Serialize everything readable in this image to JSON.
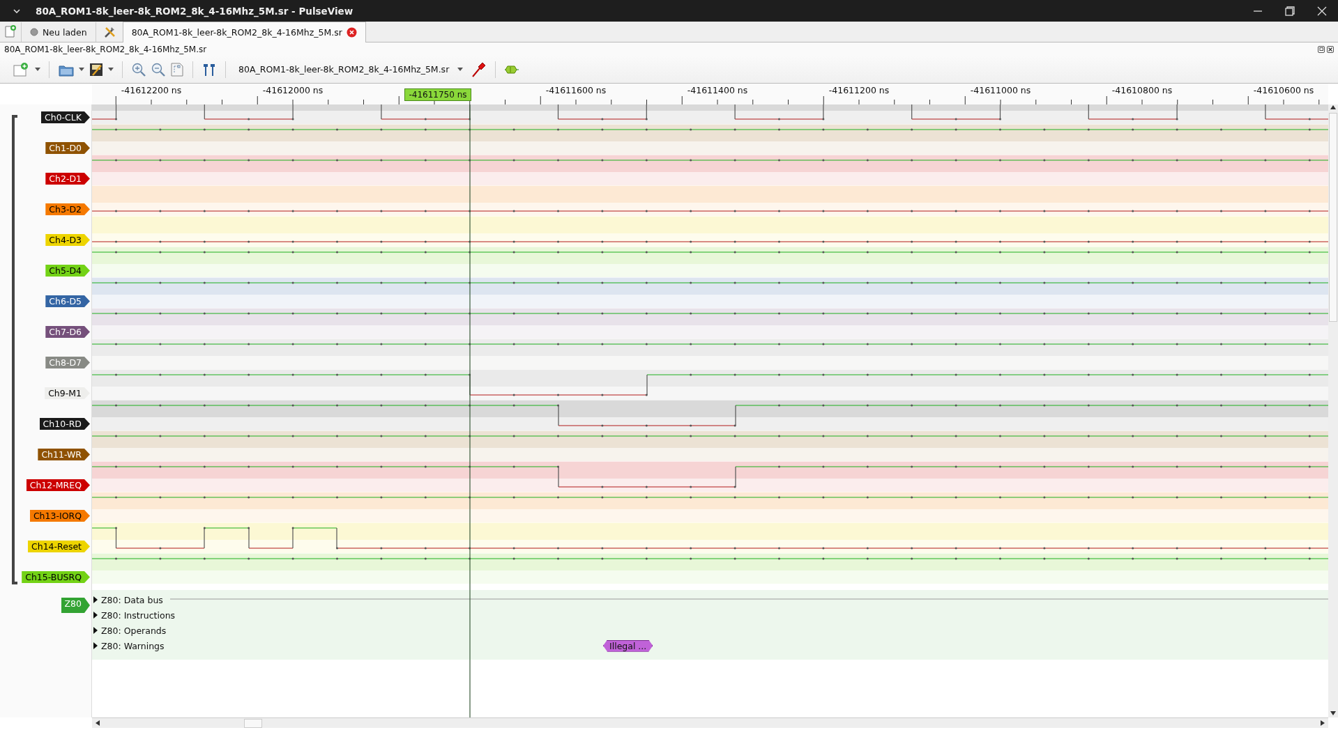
{
  "window": {
    "title": "80A_ROM1-8k_leer-8k_ROM2_8k_4-16Mhz_5M.sr - PulseView"
  },
  "tabs": [
    {
      "kind": "reload",
      "label": "Neu laden",
      "selected": false
    },
    {
      "kind": "session",
      "label": "80A_ROM1-8k_leer-8k_ROM2_8k_4-16Mhz_5M.sr",
      "selected": true
    }
  ],
  "session_label": "80A_ROM1-8k_leer-8k_ROM2_8k_4-16Mhz_5M.sr",
  "toolbar": {
    "device": "80A_ROM1-8k_leer-8k_ROM2_8k_4-16Mhz_5M.sr"
  },
  "ruler": {
    "labels": [
      "-41612200 ns",
      "-41612000 ns",
      "-41611600 ns",
      "-41611400 ns",
      "-41611200 ns",
      "-41611000 ns",
      "-41610800 ns",
      "-41610600 ns"
    ],
    "cursor": "-41611750 ns"
  },
  "channels": [
    {
      "name": "Ch0-CLK",
      "color": "#1b1b1b"
    },
    {
      "name": "Ch1-D0",
      "color": "#8f5202"
    },
    {
      "name": "Ch2-D1",
      "color": "#cc0000"
    },
    {
      "name": "Ch3-D2",
      "color": "#f57900"
    },
    {
      "name": "Ch4-D3",
      "color": "#edd400"
    },
    {
      "name": "Ch5-D4",
      "color": "#73d216"
    },
    {
      "name": "Ch6-D5",
      "color": "#3465a4"
    },
    {
      "name": "Ch7-D6",
      "color": "#75507b"
    },
    {
      "name": "Ch8-D7",
      "color": "#888a85"
    },
    {
      "name": "Ch9-M1",
      "color": "#eeeeec"
    },
    {
      "name": "Ch10-RD",
      "color": "#1b1b1b"
    },
    {
      "name": "Ch11-WR",
      "color": "#8f5202"
    },
    {
      "name": "Ch12-MREQ",
      "color": "#cc0000"
    },
    {
      "name": "Ch13-IORQ",
      "color": "#f57900"
    },
    {
      "name": "Ch14-Reset",
      "color": "#edd400"
    },
    {
      "name": "Ch15-BUSRQ",
      "color": "#73d216"
    }
  ],
  "decoder": {
    "name": "Z80",
    "color": "#33a333",
    "rows": [
      {
        "label": "Z80: Data bus",
        "expanded": false,
        "annotations": []
      },
      {
        "label": "Z80: Instructions",
        "expanded": false,
        "annotations": []
      },
      {
        "label": "Z80: Operands",
        "expanded": false,
        "annotations": []
      },
      {
        "label": "Z80: Warnings",
        "expanded": false,
        "annotations": [
          "Illegal ..."
        ]
      }
    ]
  }
}
